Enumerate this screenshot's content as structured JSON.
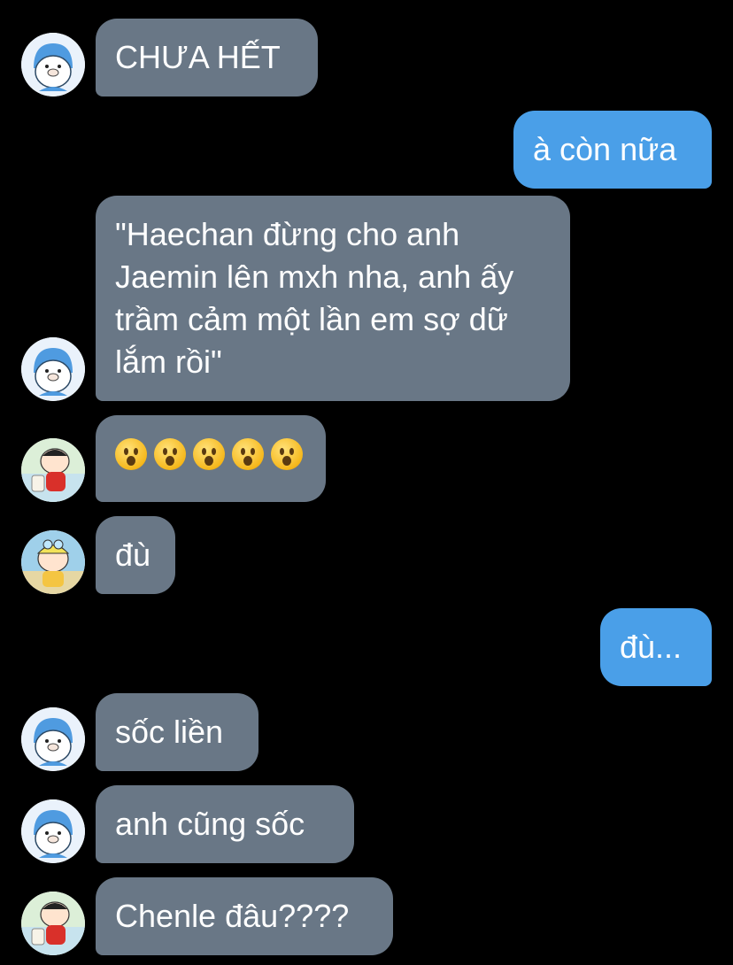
{
  "conversation": {
    "messages": [
      {
        "direction": "incoming",
        "sender_avatar": "penguin",
        "text": "CHƯA HẾT"
      },
      {
        "direction": "outgoing",
        "text": "à còn nữa"
      },
      {
        "direction": "incoming",
        "sender_avatar": "penguin",
        "text": "\"Haechan đừng cho anh Jaemin lên mxh nha, anh ấy trầm cảm một lần em sợ dữ lắm rồi\""
      },
      {
        "direction": "incoming",
        "sender_avatar": "shinchan-red",
        "emoji": [
          "hushed-face",
          "hushed-face",
          "hushed-face",
          "hushed-face",
          "hushed-face"
        ]
      },
      {
        "direction": "incoming",
        "sender_avatar": "shinchan-helmet",
        "text": "đù"
      },
      {
        "direction": "outgoing",
        "text": "đù..."
      },
      {
        "direction": "incoming",
        "sender_avatar": "penguin",
        "text": "sốc liền"
      },
      {
        "direction": "incoming",
        "sender_avatar": "penguin",
        "text": "anh cũng sốc"
      },
      {
        "direction": "incoming",
        "sender_avatar": "shinchan-red",
        "text": "Chenle đâu????"
      }
    ]
  },
  "colors": {
    "background": "#000000",
    "incoming_bubble": "#697786",
    "outgoing_bubble": "#4a9fe8",
    "text": "#ffffff"
  }
}
